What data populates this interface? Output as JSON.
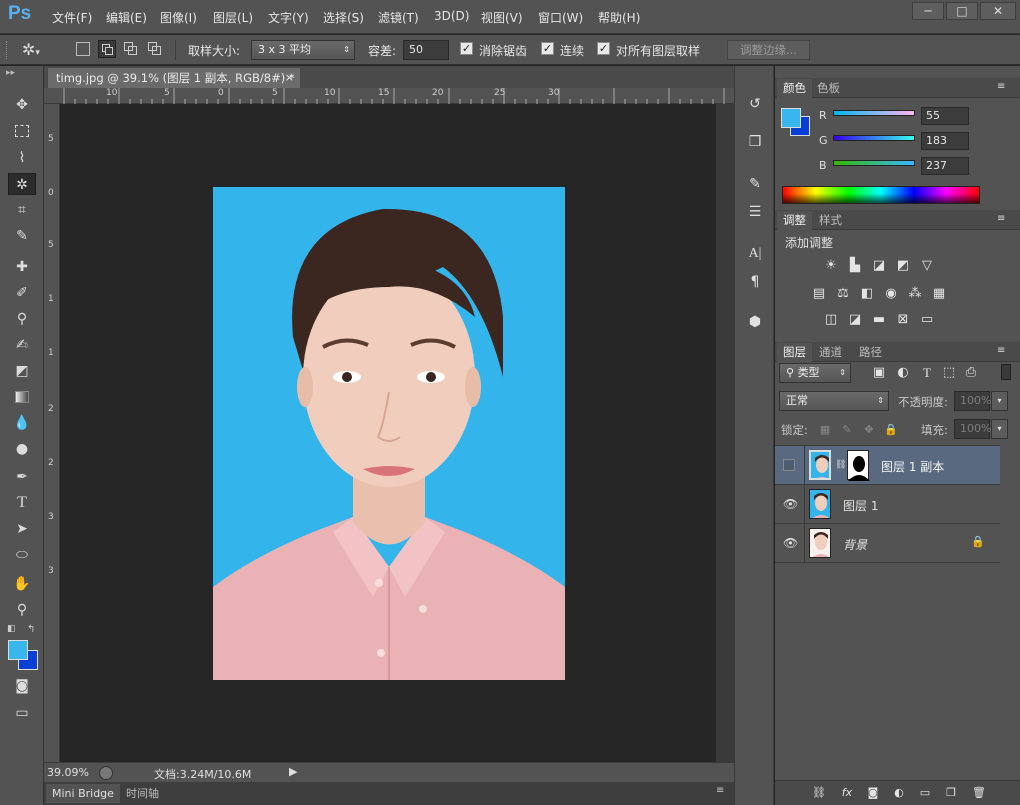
{
  "app": {
    "logo": "Ps"
  },
  "menu": [
    "文件(F)",
    "编辑(E)",
    "图像(I)",
    "图层(L)",
    "文字(Y)",
    "选择(S)",
    "滤镜(T)",
    "3D(D)",
    "视图(V)",
    "窗口(W)",
    "帮助(H)"
  ],
  "window_controls": {
    "minimize": "─",
    "maximize": "□",
    "close": "✕"
  },
  "options": {
    "sample_size_label": "取样大小:",
    "sample_size_value": "3 x 3 平均",
    "tolerance_label": "容差:",
    "tolerance_value": "50",
    "antialias_label": "消除锯齿",
    "contiguous_label": "连续",
    "sample_all_label": "对所有图层取样",
    "refine_edge_label": "调整边缘..."
  },
  "document": {
    "tab_title": "timg.jpg @ 39.1% (图层 1 副本, RGB/8#) *",
    "ruler_h_labels": [
      "10",
      "5",
      "0",
      "5",
      "10",
      "15",
      "20",
      "25",
      "30"
    ],
    "ruler_v_labels": [
      "5",
      "0",
      "5",
      "1",
      "1",
      "2",
      "2",
      "3",
      "3"
    ]
  },
  "status": {
    "zoom": "39.09%",
    "doc_size": "文档:3.24M/10.6M"
  },
  "bottom_tabs": [
    "Mini Bridge",
    "时间轴"
  ],
  "color_panel": {
    "tabs": [
      "颜色",
      "色板"
    ],
    "r_label": "R",
    "g_label": "G",
    "b_label": "B",
    "r": "55",
    "g": "183",
    "b": "237",
    "fg_color": "#37b7ed",
    "bg_color": "#0a3fd6"
  },
  "adjust_panel": {
    "tabs": [
      "调整",
      "样式"
    ],
    "title": "添加调整"
  },
  "layers_panel": {
    "tabs": [
      "图层",
      "通道",
      "路径"
    ],
    "filter_kind": "类型",
    "blend_mode": "正常",
    "opacity_label": "不透明度:",
    "opacity_value": "100%",
    "lock_label": "锁定:",
    "fill_label": "填充:",
    "fill_value": "100%",
    "layers": [
      {
        "name": "图层 1 副本"
      },
      {
        "name": "图层 1"
      },
      {
        "name": "背景"
      }
    ]
  }
}
